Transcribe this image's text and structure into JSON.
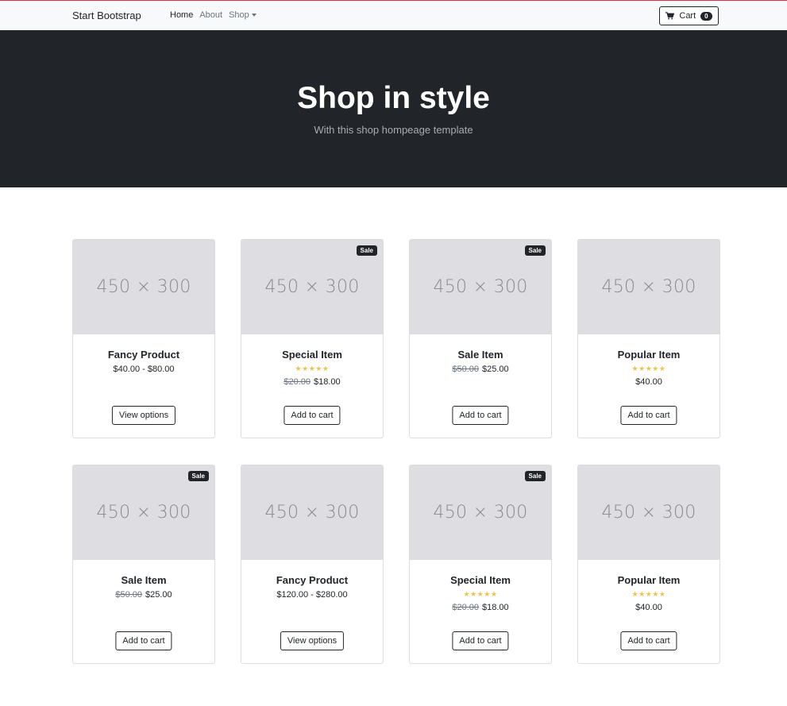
{
  "navbar": {
    "brand": "Start Bootstrap",
    "links": [
      {
        "label": "Home",
        "active": true
      },
      {
        "label": "About",
        "active": false
      },
      {
        "label": "Shop",
        "active": false,
        "dropdown": true
      }
    ],
    "cart": {
      "label": "Cart",
      "count": "0",
      "icon": "cart-icon"
    }
  },
  "hero": {
    "title": "Shop in style",
    "subtitle": "With this shop hompeage template"
  },
  "products": [
    {
      "thumb": "450 × 300",
      "title": "Fancy Product",
      "sale": "",
      "stars": 0,
      "old_price": "",
      "price": "$40.00 - $80.00",
      "button": "View options"
    },
    {
      "thumb": "450 × 300",
      "title": "Special Item",
      "sale": "Sale",
      "stars": 5,
      "old_price": "$20.00",
      "price": "$18.00",
      "button": "Add to cart"
    },
    {
      "thumb": "450 × 300",
      "title": "Sale Item",
      "sale": "Sale",
      "stars": 0,
      "old_price": "$50.00",
      "price": "$25.00",
      "button": "Add to cart"
    },
    {
      "thumb": "450 × 300",
      "title": "Popular Item",
      "sale": "",
      "stars": 5,
      "old_price": "",
      "price": "$40.00",
      "button": "Add to cart"
    },
    {
      "thumb": "450 × 300",
      "title": "Sale Item",
      "sale": "Sale",
      "stars": 0,
      "old_price": "$50.00",
      "price": "$25.00",
      "button": "Add to cart"
    },
    {
      "thumb": "450 × 300",
      "title": "Fancy Product",
      "sale": "",
      "stars": 0,
      "old_price": "",
      "price": "$120.00 - $280.00",
      "button": "View options"
    },
    {
      "thumb": "450 × 300",
      "title": "Special Item",
      "sale": "Sale",
      "stars": 5,
      "old_price": "$20.00",
      "price": "$18.00",
      "button": "Add to cart"
    },
    {
      "thumb": "450 × 300",
      "title": "Popular Item",
      "sale": "",
      "stars": 5,
      "old_price": "",
      "price": "$40.00",
      "button": "Add to cart"
    }
  ],
  "colors": {
    "accent": "#212529",
    "star": "#f0c14b",
    "hero_bg": "#212529",
    "placeholder_bg": "#dedee2"
  }
}
